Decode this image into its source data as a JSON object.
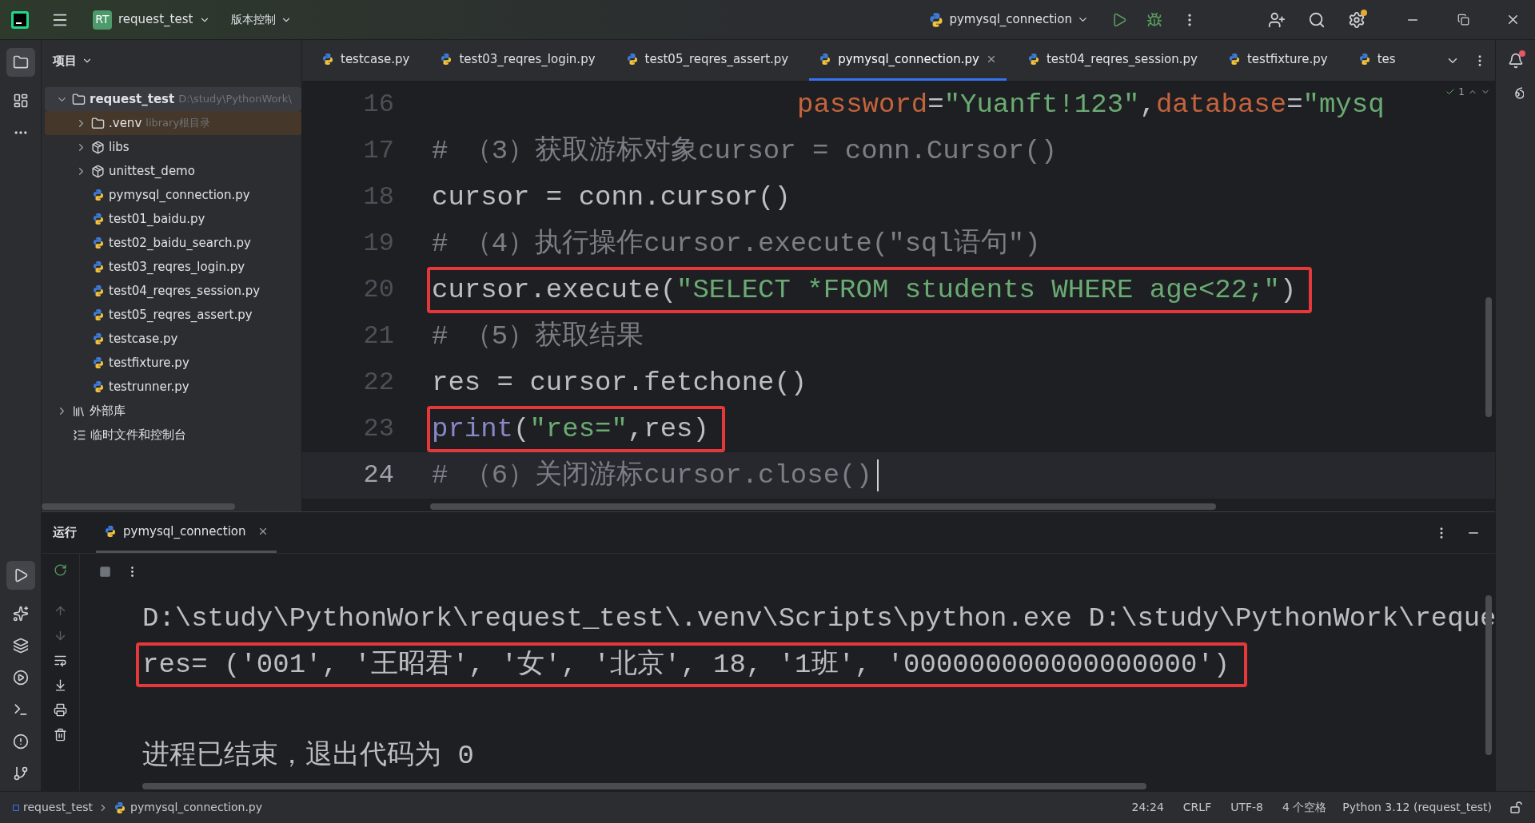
{
  "title_bar": {
    "project_badge": "RT",
    "project": "request_test",
    "vcs": "版本控制",
    "run_config": "pymysql_connection"
  },
  "project_panel": {
    "title": "项目",
    "tree": [
      {
        "label": "request_test",
        "hint": "D:\\study\\PythonWork\\",
        "kind": "folder",
        "expanded": true,
        "selected": false,
        "children": [
          {
            "label": ".venv",
            "hint": "library根目录",
            "kind": "folder",
            "expanded": false,
            "selected": true
          },
          {
            "label": "libs",
            "kind": "package",
            "expanded": false,
            "selected": false
          },
          {
            "label": "unittest_demo",
            "kind": "package",
            "expanded": false,
            "selected": false
          },
          {
            "label": "pymysql_connection.py",
            "kind": "python",
            "selected": false
          },
          {
            "label": "test01_baidu.py",
            "kind": "python",
            "selected": false
          },
          {
            "label": "test02_baidu_search.py",
            "kind": "python",
            "selected": false
          },
          {
            "label": "test03_reqres_login.py",
            "kind": "python",
            "selected": false
          },
          {
            "label": "test04_reqres_session.py",
            "kind": "python",
            "selected": false
          },
          {
            "label": "test05_reqres_assert.py",
            "kind": "python",
            "selected": false
          },
          {
            "label": "testcase.py",
            "kind": "python",
            "selected": false
          },
          {
            "label": "testfixture.py",
            "kind": "python",
            "selected": false
          },
          {
            "label": "testrunner.py",
            "kind": "python",
            "selected": false
          }
        ]
      },
      {
        "label": "外部库",
        "kind": "library",
        "expanded": false,
        "selected": false
      },
      {
        "label": "临时文件和控制台",
        "kind": "scratch",
        "selected": false
      }
    ]
  },
  "editor_tabs": [
    {
      "label": "testcase.py",
      "selected": false
    },
    {
      "label": "test03_reqres_login.py",
      "selected": false
    },
    {
      "label": "test05_reqres_assert.py",
      "selected": false
    },
    {
      "label": "pymysql_connection.py",
      "selected": true
    },
    {
      "label": "test04_reqres_session.py",
      "selected": false
    },
    {
      "label": "testfixture.py",
      "selected": false
    },
    {
      "label": "tes",
      "selected": false
    }
  ],
  "inspections": "1",
  "code_lines": [
    {
      "number": "16",
      "kind": "continuation",
      "boxed": false,
      "current": false,
      "segments": [
        {
          "text": "password",
          "kind": "param"
        },
        {
          "text": "=",
          "kind": "plain"
        },
        {
          "text": "\"Yuanft!123\"",
          "kind": "string"
        },
        {
          "text": ",",
          "kind": "plain"
        },
        {
          "text": "database",
          "kind": "param"
        },
        {
          "text": "=",
          "kind": "plain"
        },
        {
          "text": "\"mysq",
          "kind": "string"
        }
      ]
    },
    {
      "number": "17",
      "kind": "normal",
      "boxed": false,
      "current": false,
      "segments": [
        {
          "text": "# （3）获取游标对象cursor = conn.Cursor()",
          "kind": "comment"
        }
      ]
    },
    {
      "number": "18",
      "kind": "normal",
      "boxed": false,
      "current": false,
      "segments": [
        {
          "text": "cursor = conn.cursor()",
          "kind": "plain"
        }
      ]
    },
    {
      "number": "19",
      "kind": "normal",
      "boxed": false,
      "current": false,
      "segments": [
        {
          "text": "# （4）执行操作cursor.execute(\"sql语句\")",
          "kind": "comment"
        }
      ]
    },
    {
      "number": "20",
      "kind": "normal",
      "boxed": true,
      "current": false,
      "segments": [
        {
          "text": "cursor.execute(",
          "kind": "plain"
        },
        {
          "text": "\"SELECT *FROM students WHERE age<22;\"",
          "kind": "string"
        },
        {
          "text": ")",
          "kind": "plain"
        }
      ]
    },
    {
      "number": "21",
      "kind": "normal",
      "boxed": false,
      "current": false,
      "segments": [
        {
          "text": "# （5）获取结果",
          "kind": "comment"
        }
      ]
    },
    {
      "number": "22",
      "kind": "normal",
      "boxed": false,
      "current": false,
      "segments": [
        {
          "text": "res = cursor.fetchone()",
          "kind": "plain"
        }
      ]
    },
    {
      "number": "23",
      "kind": "normal",
      "boxed": true,
      "current": false,
      "segments": [
        {
          "text": "print",
          "kind": "builtin"
        },
        {
          "text": "(",
          "kind": "plain"
        },
        {
          "text": "\"res=\"",
          "kind": "string"
        },
        {
          "text": ",res)",
          "kind": "plain"
        }
      ]
    },
    {
      "number": "24",
      "kind": "normal",
      "boxed": false,
      "current": true,
      "segments": [
        {
          "text": "# （6）关闭游标cursor.close()",
          "kind": "comment"
        }
      ]
    }
  ],
  "run_panel": {
    "title": "运行",
    "tab": "pymysql_connection",
    "console": [
      {
        "text": "D:\\study\\PythonWork\\request_test\\.venv\\Scripts\\python.exe D:\\study\\PythonWork\\reque",
        "boxed": false
      },
      {
        "text": "res= ('001', '王昭君', '女', '北京', 18, '1班', '000000000000000000')",
        "boxed": true
      },
      {
        "text": "进程已结束，退出代码为 0",
        "boxed": false
      }
    ]
  },
  "status_bar": {
    "breadcrumbs": [
      "request_test",
      "pymysql_connection.py"
    ],
    "position": "24:24",
    "line_ending": "CRLF",
    "encoding": "UTF-8",
    "indent": "4 个空格",
    "interpreter": "Python 3.12 (request_test)"
  }
}
